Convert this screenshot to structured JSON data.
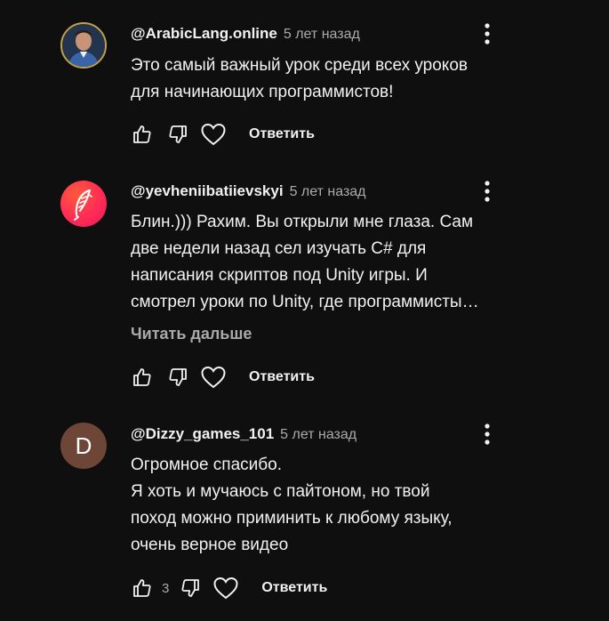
{
  "comments": [
    {
      "author": "@ArabicLang.online",
      "time": "5 лет назад",
      "lines": [
        "Это самый важный урок среди всех уроков",
        "для начинающих программистов!"
      ],
      "likes": "",
      "reply_label": "Ответить",
      "avatar": "photo"
    },
    {
      "author": "@yevheniibatiievskyi",
      "time": "5 лет назад",
      "lines": [
        "Блин.))) Рахим. Вы открыли мне глаза. Сам",
        "две недели назад сел изучать C# для",
        "написания скриптов под Unity игры. И",
        "смотрел уроки по Unity, где программисты…"
      ],
      "read_more": "Читать дальше",
      "likes": "",
      "reply_label": "Ответить",
      "avatar": "feather-logo"
    },
    {
      "author": "@Dizzy_games_101",
      "time": "5 лет назад",
      "lines": [
        "Огромное спасибо.",
        "Я хоть и мучаюсь с пайтоном, но твой",
        "поход можно приминить к любому языку,",
        "очень верное видео"
      ],
      "likes": "3",
      "reply_label": "Ответить",
      "avatar_letter": "D",
      "avatar": "letter"
    }
  ],
  "icons": {
    "like": "thumb-up-icon",
    "dislike": "thumb-down-icon",
    "heart": "heart-icon",
    "menu": "more-vert-icon"
  },
  "colors": {
    "background": "#0f0f0f",
    "text": "#f1f1f1",
    "secondary": "#aaaaaa",
    "letter_avatar": "#6e4637",
    "brand_avatar": "#ff2c55"
  }
}
